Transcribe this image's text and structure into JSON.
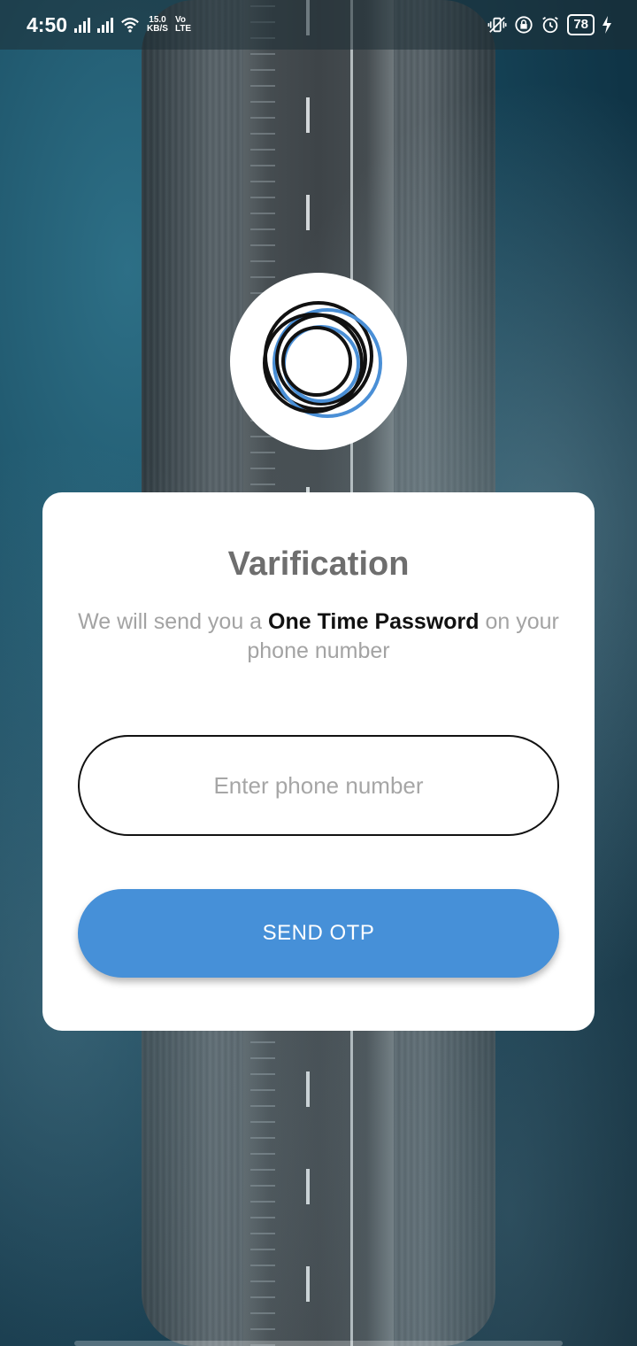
{
  "status_bar": {
    "time": "4:50",
    "net_speed_value": "15.0",
    "net_speed_unit": "KB/S",
    "network_vo": "Vo",
    "network_lte": "LTE",
    "battery": "78"
  },
  "card": {
    "title": "Varification",
    "subtitle_pre": "We will send you a ",
    "subtitle_bold": "One Time Password",
    "subtitle_post": " on your phone number",
    "phone_input": {
      "value": "",
      "placeholder": "Enter phone number"
    },
    "send_button_label": "SEND OTP"
  },
  "colors": {
    "accent": "#4690d8",
    "title": "#6e6e6e",
    "subtitle": "#a3a3a3"
  },
  "icons": [
    "wifi-icon",
    "signal-icon",
    "vibrate-icon",
    "lock-rotation-icon",
    "alarm-icon",
    "charging-icon"
  ]
}
